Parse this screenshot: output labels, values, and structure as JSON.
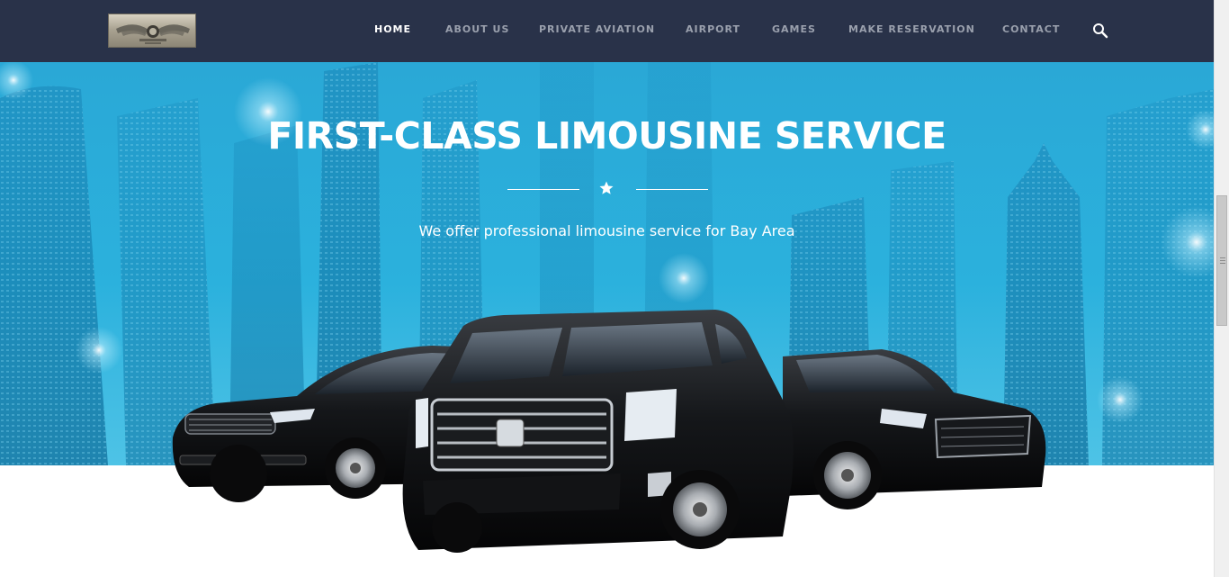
{
  "header": {
    "logo_icon": "winged-emblem-logo",
    "nav": [
      {
        "label": "HOME",
        "active": true
      },
      {
        "label": "ABOUT US",
        "active": false
      },
      {
        "label": "PRIVATE AVIATION",
        "active": false
      },
      {
        "label": "AIRPORT",
        "active": false
      },
      {
        "label": "GAMES",
        "active": false
      },
      {
        "label": "MAKE RESERVATION",
        "active": false
      },
      {
        "label": "CONTACT",
        "active": false
      }
    ],
    "search_icon": "search-icon"
  },
  "hero": {
    "title": "FIRST-CLASS LIMOUSINE SERVICE",
    "divider_icon": "star-icon",
    "subtitle": "We offer professional limousine service for Bay Area"
  },
  "colors": {
    "header_bg": "#293249",
    "hero_blue": "#2aa8d6",
    "nav_text": "#9aa0ad",
    "nav_active": "#ffffff"
  }
}
